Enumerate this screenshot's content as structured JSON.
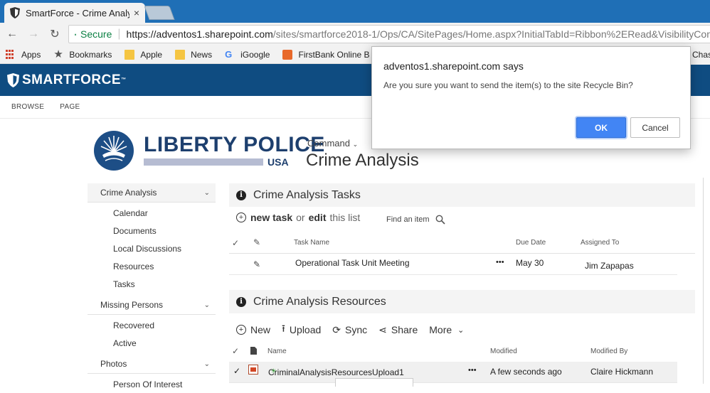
{
  "browser": {
    "tab_title": "SmartForce - Crime Analy",
    "tab_close": "×",
    "secure_label": "Secure",
    "url_host": "https://adventos1.sharepoint.com",
    "url_path": "/sites/smartforce2018-1/Ops/CA/SitePages/Home.aspx?InitialTabId=Ribbon%2ERead&VisibilityCon",
    "bookmarks": [
      {
        "label": "Apps"
      },
      {
        "label": "Bookmarks"
      },
      {
        "label": "Apple"
      },
      {
        "label": "News"
      },
      {
        "label": "iGoogle"
      },
      {
        "label": "FirstBank Online B"
      }
    ],
    "bookmark_overflow": "Chase"
  },
  "suitebar": {
    "brand": "SMARTFORCE",
    "tm": "™"
  },
  "ribbon": {
    "tabs": [
      "BROWSE",
      "PAGE"
    ]
  },
  "site": {
    "logo_main": "LIBERTY POLICE",
    "logo_sub": "USA",
    "command_label": "Command",
    "title": "Crime Analysis"
  },
  "leftnav": {
    "sections": [
      {
        "label": "Crime Analysis",
        "items": [
          "Calendar",
          "Documents",
          "Local Discussions",
          "Resources",
          "Tasks"
        ]
      },
      {
        "label": "Missing Persons",
        "items": [
          "Recovered",
          "Active"
        ]
      },
      {
        "label": "Photos",
        "items": [
          "Person Of Interest"
        ]
      }
    ]
  },
  "tasks": {
    "title": "Crime Analysis Tasks",
    "new_label": "new task",
    "or_label": "or",
    "edit_label": "edit",
    "this_list_label": "this list",
    "find_label": "Find an item",
    "columns": {
      "name": "Task Name",
      "due": "Due Date",
      "assigned": "Assigned To"
    },
    "rows": [
      {
        "name": "Operational Task Unit Meeting",
        "menu": "•••",
        "due": "May 30",
        "assigned": "Jim Zapapas"
      }
    ]
  },
  "resources": {
    "title": "Crime Analysis Resources",
    "toolbar": {
      "new": "New",
      "upload": "Upload",
      "sync": "Sync",
      "share": "Share",
      "more": "More"
    },
    "columns": {
      "name": "Name",
      "modified": "Modified",
      "modified_by": "Modified By"
    },
    "rows": [
      {
        "name": "CriminalAnalysisResourcesUpload1",
        "menu": "•••",
        "modified": "A few seconds ago",
        "modified_by": "Claire Hickmann"
      }
    ]
  },
  "dialog": {
    "title": "adventos1.sharepoint.com says",
    "message": "Are you sure you want to send the item(s) to the site Recycle Bin?",
    "ok": "OK",
    "cancel": "Cancel"
  },
  "colors": {
    "suitebar": "#0f4c81",
    "ok_button": "#4285f4",
    "secure_green": "#0b8043"
  }
}
